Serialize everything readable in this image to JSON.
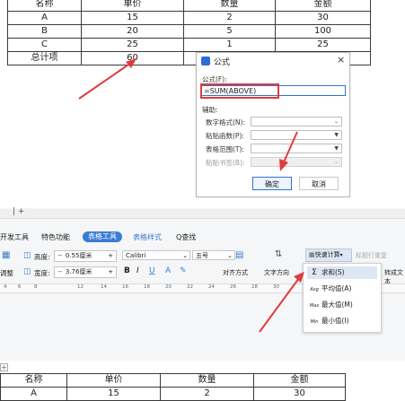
{
  "top_table": {
    "headers": [
      "名称",
      "单价",
      "数量",
      "金额"
    ],
    "rows": [
      [
        "A",
        "15",
        "2",
        "30"
      ],
      [
        "B",
        "20",
        "5",
        "100"
      ],
      [
        "C",
        "25",
        "1",
        "25"
      ]
    ],
    "total_row": [
      "总计项",
      "60"
    ]
  },
  "dialog": {
    "title": "公式",
    "close_glyph": "×",
    "formula_label": "公式(F):",
    "formula_value": "=SUM(ABOVE)",
    "assist_label": "辅助:",
    "number_format_label": "数字格式(N):",
    "paste_function_label": "粘贴函数(P):",
    "table_range_label": "表格范围(T):",
    "paste_bookmark_label": "粘贴书签(B):",
    "ok_label": "确定",
    "cancel_label": "取消"
  },
  "ribbon": {
    "menu_items": [
      "开发工具",
      "特色功能",
      "表格工具",
      "表格样式",
      "Q查找"
    ],
    "height_label": "高度:",
    "height_value": "0.55厘米",
    "width_label": "宽度:",
    "width_value": "3.76厘米",
    "left_partial_1": "调整",
    "font_name": "Calibri",
    "font_size": "五号",
    "align_label": "对齐方式",
    "text_dir_label": "文字方向",
    "quick_calc_label": "快速计算",
    "header_repeat_label": "标题行重复",
    "convert_text_label": "转成文本",
    "ruler_ticks": [
      "4",
      "6",
      "8",
      "10",
      "12",
      "14",
      "16",
      "18",
      "20",
      "22",
      "24",
      "26",
      "28",
      "30",
      "32",
      "34",
      "36",
      "38",
      "40",
      "44",
      "46"
    ]
  },
  "dropdown": {
    "items": [
      {
        "icon": "Σ",
        "label": "求和(S)"
      },
      {
        "icon": "Avg",
        "label": "平均值(A)"
      },
      {
        "icon": "Max",
        "label": "最大值(M)"
      },
      {
        "icon": "Min",
        "label": "最小值(I)"
      }
    ]
  },
  "bottom_table": {
    "headers": [
      "名称",
      "单价",
      "数量",
      "金额"
    ],
    "rows": [
      [
        "A",
        "15",
        "2",
        "30"
      ]
    ]
  },
  "colors": {
    "accent": "#3a7bd5",
    "arrow_red": "#e23b3b",
    "highlight": "#dde6f3"
  }
}
